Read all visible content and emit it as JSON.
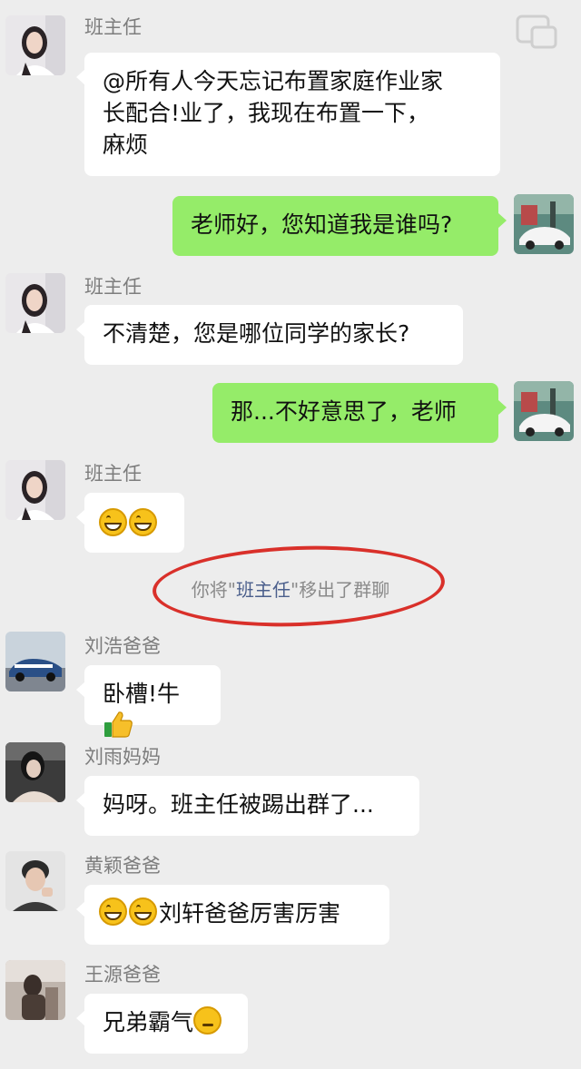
{
  "messages": [
    {
      "sender": "班主任",
      "text": "@所有人今天忘记布置家庭作业家\n长配合!业了，我现在布置一下，\n麻烦"
    },
    {
      "sender": "me",
      "text": "老师好，您知道我是谁吗?"
    },
    {
      "sender": "班主任",
      "text": "不清楚，您是哪位同学的家长?"
    },
    {
      "sender": "me",
      "text": "那...不好意思了，老师"
    },
    {
      "sender": "班主任",
      "emoji": [
        "grin-emoji",
        "grin-emoji"
      ]
    },
    {
      "sender": "刘浩爸爸",
      "text": "卧槽!牛",
      "emoji": [
        "thumbs-up-emoji"
      ]
    },
    {
      "sender": "刘雨妈妈",
      "text": "妈呀。班主任被踢出群了..."
    },
    {
      "sender": "黄颖爸爸",
      "text": "刘轩爸爸厉害厉害",
      "emoji": [
        "grin-emoji",
        "grin-emoji"
      ]
    },
    {
      "sender": "王源爸爸",
      "text": "兄弟霸气",
      "emoji": [
        "thinking-emoji"
      ]
    }
  ],
  "system_notice": {
    "prefix": "你将\"",
    "highlight": "班主任",
    "suffix": "\"移出了群聊"
  },
  "colors": {
    "background": "#ededed",
    "incoming_bubble": "#ffffff",
    "outgoing_bubble": "#95ec69",
    "annotation_circle": "#d9302a"
  },
  "icons": {
    "top_right": "fullscreen-toggle-icon"
  }
}
